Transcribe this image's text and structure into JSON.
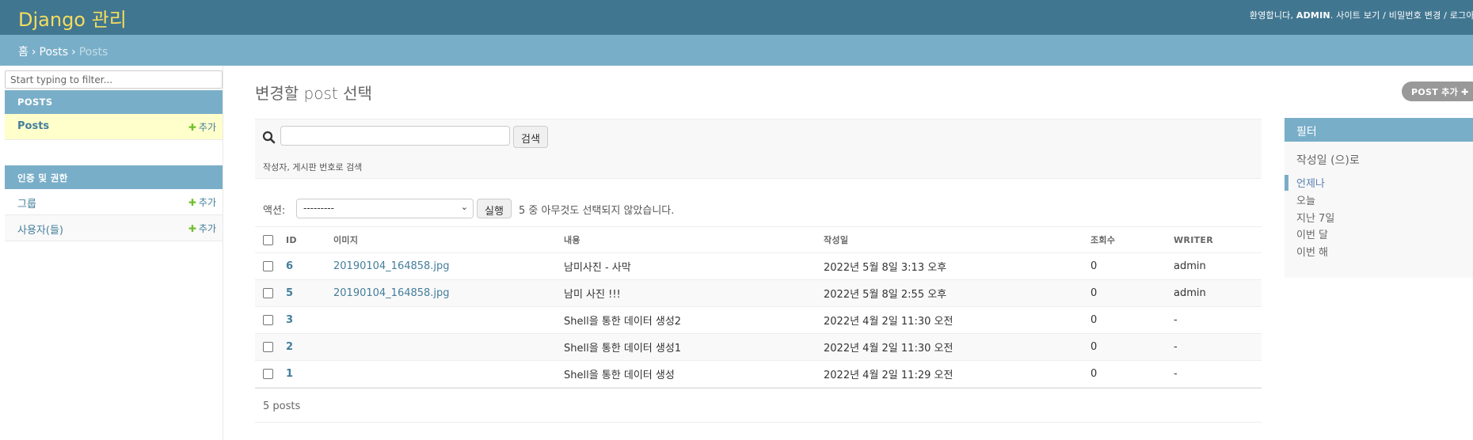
{
  "header": {
    "branding": "Django 관리",
    "welcome": "환영합니다,",
    "username": "ADMIN",
    "links": [
      "사이트 보기",
      "비밀번호 변경",
      "로그아웃"
    ]
  },
  "breadcrumbs": [
    "홈",
    "Posts",
    "Posts"
  ],
  "sidebar": {
    "filter_placeholder": "Start typing to filter...",
    "modules": [
      {
        "caption": "POSTS",
        "models": [
          {
            "name": "Posts",
            "add": "추가",
            "current": true
          }
        ]
      },
      {
        "caption": "인증 및 권한",
        "models": [
          {
            "name": "그룹",
            "add": "추가"
          },
          {
            "name": "사용자(들)",
            "add": "추가"
          }
        ]
      }
    ]
  },
  "content": {
    "title": "변경할 post 선택",
    "add_button": "POST 추가",
    "search": {
      "button": "검색",
      "value": "",
      "help": "작성자, 게시판 번호로 검색"
    },
    "actions": {
      "label": "액션:",
      "selected": "---------",
      "run": "실행",
      "counter": "5 중 아무것도 선택되지 않았습니다."
    },
    "columns": [
      "ID",
      "이미지",
      "내용",
      "작성일",
      "조회수",
      "WRITER"
    ],
    "rows": [
      {
        "id": "6",
        "image": "20190104_164858.jpg",
        "content": "남미사진 - 사막",
        "date": "2022년 5월 8일 3:13 오후",
        "views": "0",
        "writer": "admin"
      },
      {
        "id": "5",
        "image": "20190104_164858.jpg",
        "content": "남미 사진 !!!",
        "date": "2022년 5월 8일 2:55 오후",
        "views": "0",
        "writer": "admin"
      },
      {
        "id": "3",
        "image": "",
        "content": "Shell을 통한 데이터 생성2",
        "date": "2022년 4월 2일 11:30 오전",
        "views": "0",
        "writer": "-"
      },
      {
        "id": "2",
        "image": "",
        "content": "Shell을 통한 데이터 생성1",
        "date": "2022년 4월 2일 11:30 오전",
        "views": "0",
        "writer": "-"
      },
      {
        "id": "1",
        "image": "",
        "content": "Shell을 통한 데이터 생성",
        "date": "2022년 4월 2일 11:29 오전",
        "views": "0",
        "writer": "-"
      }
    ],
    "paginator": "5 posts"
  },
  "filter": {
    "title": "필터",
    "heading": "작성일 (으)로",
    "options": [
      "언제나",
      "오늘",
      "지난 7일",
      "이번 달",
      "이번 해"
    ],
    "selected_index": 0
  },
  "colors": {
    "header": "#417690",
    "breadcrumbs": "#79aec8",
    "branding": "#f5dd5d",
    "link": "#447e9b",
    "add": "#70bf2b"
  }
}
